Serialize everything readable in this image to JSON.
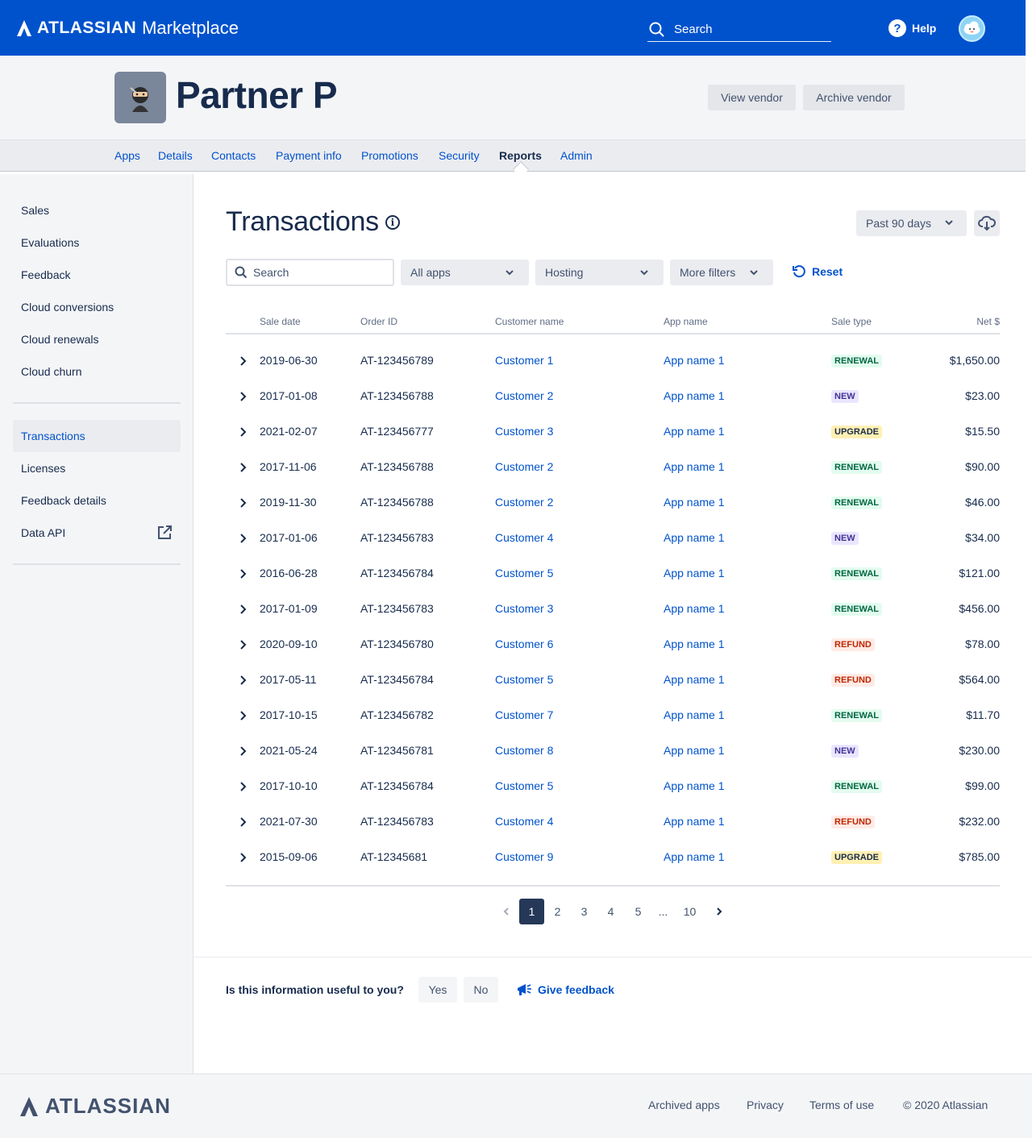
{
  "topbar": {
    "brand": "ATLASSIAN",
    "product": "Marketplace",
    "search_label": "Search",
    "help_label": "Help",
    "help_glyph": "?"
  },
  "header": {
    "vendor_name": "Partner P",
    "view_vendor": "View vendor",
    "archive_vendor": "Archive vendor"
  },
  "tabs": [
    "Apps",
    "Details",
    "Contacts",
    "Payment info",
    "Promotions",
    "Security",
    "Reports",
    "Admin"
  ],
  "active_tab": "Reports",
  "sidebar": {
    "group1": [
      "Sales",
      "Evaluations",
      "Feedback",
      "Cloud conversions",
      "Cloud renewals",
      "Cloud churn"
    ],
    "group2": [
      "Transactions",
      "Licenses",
      "Feedback details",
      "Data API"
    ],
    "active": "Transactions"
  },
  "main": {
    "title": "Transactions",
    "info_glyph": "i",
    "period": "Past 90 days",
    "search_placeholder": "Search",
    "filters": {
      "apps": "All apps",
      "hosting": "Hosting",
      "more": "More filters",
      "reset": "Reset"
    }
  },
  "table": {
    "columns": {
      "sale_date": "Sale date",
      "order_id": "Order ID",
      "customer": "Customer name",
      "app": "App name",
      "sale_type": "Sale type",
      "net": "Net $"
    },
    "rows": [
      {
        "date": "2019-06-30",
        "order": "AT-123456789",
        "customer": "Customer 1",
        "app": "App name 1",
        "type": "RENEWAL",
        "net": "$1,650.00"
      },
      {
        "date": "2017-01-08",
        "order": "AT-123456788",
        "customer": "Customer 2",
        "app": "App name 1",
        "type": "NEW",
        "net": "$23.00"
      },
      {
        "date": "2021-02-07",
        "order": "AT-123456777",
        "customer": "Customer 3",
        "app": "App name 1",
        "type": "UPGRADE",
        "net": "$15.50"
      },
      {
        "date": "2017-11-06",
        "order": "AT-123456788",
        "customer": "Customer 2",
        "app": "App name 1",
        "type": "RENEWAL",
        "net": "$90.00"
      },
      {
        "date": "2019-11-30",
        "order": "AT-123456788",
        "customer": "Customer 2",
        "app": "App name 1",
        "type": "RENEWAL",
        "net": "$46.00"
      },
      {
        "date": "2017-01-06",
        "order": "AT-123456783",
        "customer": "Customer 4",
        "app": "App name 1",
        "type": "NEW",
        "net": "$34.00"
      },
      {
        "date": "2016-06-28",
        "order": "AT-123456784",
        "customer": "Customer 5",
        "app": "App name 1",
        "type": "RENEWAL",
        "net": "$121.00"
      },
      {
        "date": "2017-01-09",
        "order": "AT-123456783",
        "customer": "Customer 3",
        "app": "App name 1",
        "type": "RENEWAL",
        "net": "$456.00"
      },
      {
        "date": "2020-09-10",
        "order": "AT-123456780",
        "customer": "Customer 6",
        "app": "App name 1",
        "type": "REFUND",
        "net": "$78.00"
      },
      {
        "date": "2017-05-11",
        "order": "AT-123456784",
        "customer": "Customer 5",
        "app": "App name 1",
        "type": "REFUND",
        "net": "$564.00"
      },
      {
        "date": "2017-10-15",
        "order": "AT-123456782",
        "customer": "Customer 7",
        "app": "App name 1",
        "type": "RENEWAL",
        "net": "$11.70"
      },
      {
        "date": "2021-05-24",
        "order": "AT-123456781",
        "customer": "Customer 8",
        "app": "App name 1",
        "type": "NEW",
        "net": "$230.00"
      },
      {
        "date": "2017-10-10",
        "order": "AT-123456784",
        "customer": "Customer 5",
        "app": "App name 1",
        "type": "RENEWAL",
        "net": "$99.00"
      },
      {
        "date": "2021-07-30",
        "order": "AT-123456783",
        "customer": "Customer 4",
        "app": "App name 1",
        "type": "REFUND",
        "net": "$232.00"
      },
      {
        "date": "2015-09-06",
        "order": "AT-12345681",
        "customer": "Customer 9",
        "app": "App name 1",
        "type": "UPGRADE",
        "net": "$785.00"
      }
    ]
  },
  "pagination": {
    "pages": [
      "1",
      "2",
      "3",
      "4",
      "5",
      "...",
      "10"
    ],
    "current": "1"
  },
  "feedback": {
    "question": "Is this information useful to you?",
    "yes": "Yes",
    "no": "No",
    "give": "Give feedback"
  },
  "footer": {
    "brand": "ATLASSIAN",
    "links": [
      "Archived apps",
      "Privacy",
      "Terms of use",
      "© 2020 Atlassian"
    ]
  },
  "colors": {
    "brand_blue": "#0052CC",
    "text": "#172B4D",
    "subtle": "#42526E"
  },
  "icons": {
    "search": "search-icon",
    "help": "help-icon",
    "download": "cloud-download-icon",
    "reset": "refresh-icon",
    "external": "external-link-icon",
    "megaphone": "megaphone-icon"
  }
}
